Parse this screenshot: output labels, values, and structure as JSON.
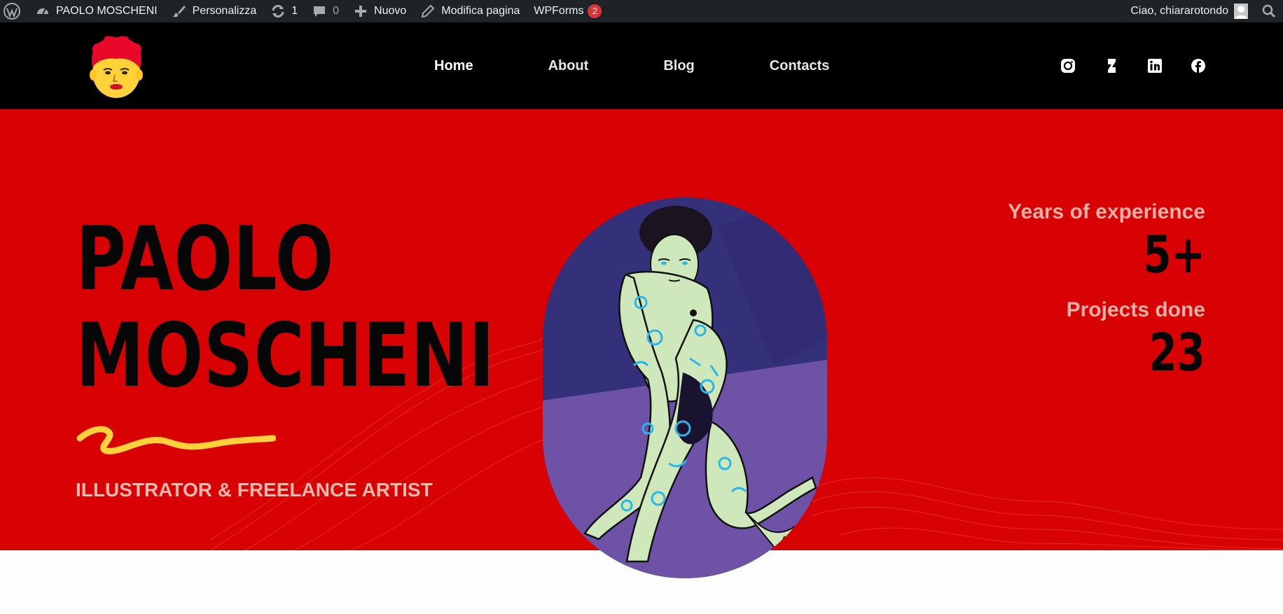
{
  "adminbar": {
    "site_name": "PAOLO MOSCHENI",
    "customize": "Personalizza",
    "updates_count": "1",
    "comments_count": "0",
    "new": "Nuovo",
    "edit_page": "Modifica pagina",
    "wpforms": "WPForms",
    "wpforms_badge": "2",
    "greeting": "Ciao, chiararotondo"
  },
  "nav": {
    "items": [
      {
        "label": "Home",
        "active": true
      },
      {
        "label": "About"
      },
      {
        "label": "Blog"
      },
      {
        "label": "Contacts"
      }
    ]
  },
  "social": [
    "instagram-icon",
    "deviantart-icon",
    "linkedin-icon",
    "facebook-icon"
  ],
  "hero": {
    "name_line1": "PAOLO",
    "name_line2": "MOSCHENI",
    "subtitle": "ILLUSTRATOR & FREELANCE ARTIST",
    "stats": [
      {
        "label": "Years of experience",
        "value": "5+"
      },
      {
        "label": "Projects done",
        "value": "23"
      }
    ]
  },
  "colors": {
    "adminbar_bg": "#1d2327",
    "header_bg": "#000000",
    "hero_bg": "#d80204",
    "accent_yellow": "#ffd23a",
    "label_pink": "#f0b0a6"
  }
}
